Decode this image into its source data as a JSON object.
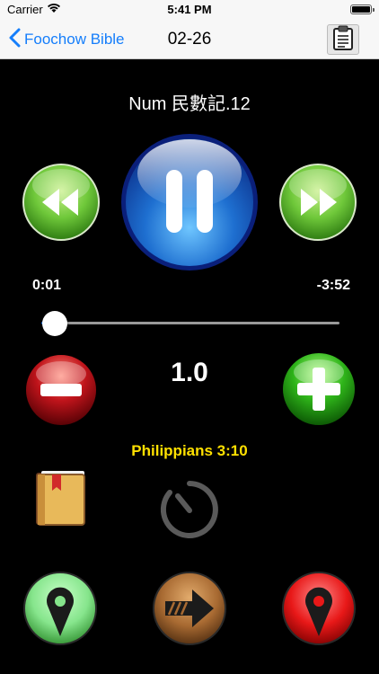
{
  "status_bar": {
    "carrier": "Carrier",
    "time": "5:41 PM"
  },
  "nav": {
    "back_label": "Foochow Bible",
    "title": "02-26"
  },
  "player": {
    "track_title": "Num 民數記.12",
    "elapsed": "0:01",
    "remaining": "-3:52",
    "progress_fraction": 0.004,
    "speed": "1.0",
    "reference": "Philippians 3:10"
  },
  "icons": {
    "back": "chevron-left-icon",
    "clipboard": "clipboard-icon",
    "rewind": "rewind-icon",
    "pause": "pause-icon",
    "fast_forward": "fast-forward-icon",
    "minus": "minus-icon",
    "plus": "plus-icon",
    "book": "book-icon",
    "timer": "timer-icon",
    "pin_green": "map-pin-icon",
    "arrow": "forward-arrow-icon",
    "pin_red": "map-pin-icon"
  },
  "colors": {
    "ios_blue": "#157efb",
    "reference_yellow": "#ffe000",
    "green_button": "#6fc83a",
    "blue_button": "#1e6fd0",
    "red_button": "#c0141b",
    "brown_button": "#8b5a2b"
  }
}
